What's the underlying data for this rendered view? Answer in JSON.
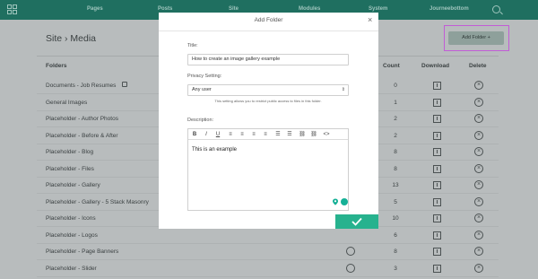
{
  "nav": {
    "items": [
      "Pages",
      "Posts",
      "Site",
      "Modules",
      "System",
      "Journeebottom"
    ]
  },
  "page": {
    "title": "Site › Media",
    "add_folder_button": "Add Folder  +",
    "columns": {
      "folders": "Folders",
      "count": "Count",
      "download": "Download",
      "delete": "Delete"
    },
    "rows": [
      {
        "name": "Documents - Job Resumes",
        "count": "0",
        "locked": true,
        "globe": false
      },
      {
        "name": "General Images",
        "count": "1",
        "locked": false,
        "globe": false
      },
      {
        "name": "Placeholder - Author Photos",
        "count": "2",
        "locked": false,
        "globe": false
      },
      {
        "name": "Placeholder - Before & After",
        "count": "2",
        "locked": false,
        "globe": false
      },
      {
        "name": "Placeholder - Blog",
        "count": "8",
        "locked": false,
        "globe": false
      },
      {
        "name": "Placeholder - Files",
        "count": "8",
        "locked": false,
        "globe": false
      },
      {
        "name": "Placeholder - Gallery",
        "count": "13",
        "locked": false,
        "globe": false
      },
      {
        "name": "Placeholder - Gallery - 5 Stack Masonry",
        "count": "5",
        "locked": false,
        "globe": false
      },
      {
        "name": "Placeholder - Icons",
        "count": "10",
        "locked": false,
        "globe": false
      },
      {
        "name": "Placeholder - Logos",
        "count": "6",
        "locked": false,
        "globe": false
      },
      {
        "name": "Placeholder - Page Banners",
        "count": "8",
        "locked": false,
        "globe": true
      },
      {
        "name": "Placeholder - Slider",
        "count": "3",
        "locked": false,
        "globe": true
      }
    ]
  },
  "modal": {
    "title": "Add Folder",
    "close": "×",
    "title_label": "Title:",
    "title_value": "How to create an image gallery example",
    "privacy_label": "Privacy Setting:",
    "privacy_value": "Any user",
    "privacy_hint": "This setting allows you to restrict public access to files in this folder.",
    "description_label": "Description:",
    "description_value": "This is an example",
    "toolbar": [
      "B",
      "I",
      "U",
      "≡",
      "≡",
      "≡",
      "≡",
      "☰",
      "☰",
      "⛓",
      "⛓",
      "<>"
    ]
  },
  "colors": {
    "nav_bg": "#1f6f60",
    "accent": "#27b28e",
    "highlight": "#c25dd6"
  }
}
